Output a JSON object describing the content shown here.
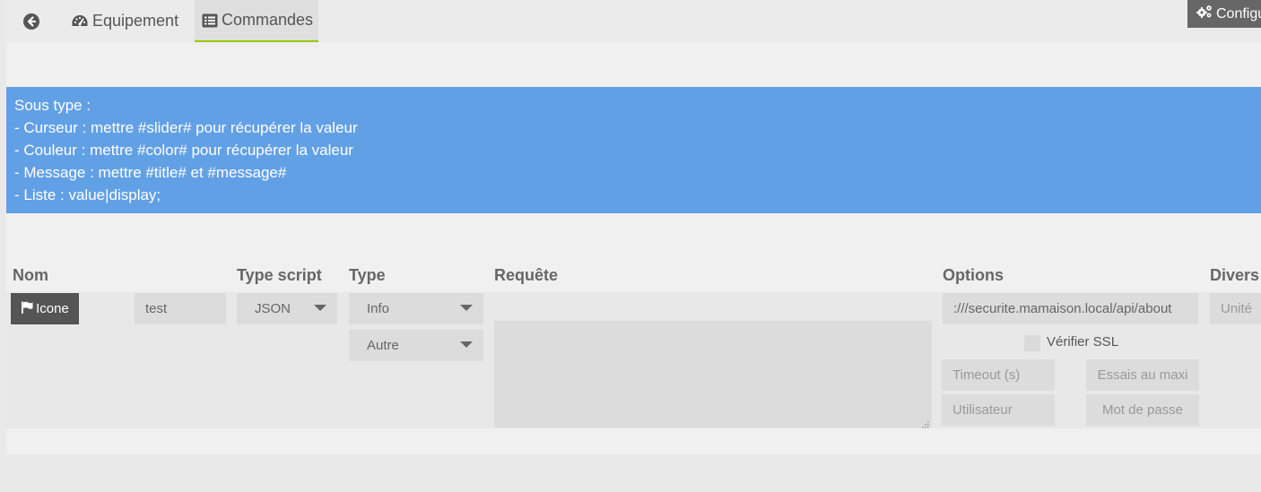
{
  "tabs": {
    "back_icon": "arrow-circle-left-icon",
    "equipement": {
      "label": "Equipement",
      "icon": "tachometer-icon"
    },
    "commandes": {
      "label": "Commandes",
      "icon": "list-alt-icon"
    }
  },
  "config_button": {
    "label": "Configu",
    "icon": "cogs-icon"
  },
  "alert": {
    "lines": [
      "Sous type :",
      "- Curseur : mettre #slider# pour récupérer la valeur",
      "- Couleur : mettre #color# pour récupérer la valeur",
      "- Message : mettre #title# et #message#",
      "- Liste : value|display;"
    ]
  },
  "table": {
    "headers": {
      "nom": "Nom",
      "type_script": "Type script",
      "type": "Type",
      "requete": "Requête",
      "options": "Options",
      "divers": "Divers"
    },
    "row": {
      "icone_button": {
        "label": "Icone",
        "icon": "flag-icon"
      },
      "name_value": "test",
      "type_script_value": "JSON",
      "type_value": "Info",
      "subtype_value": "Autre",
      "requete_value": "",
      "url_value": ":///securite.mamaison.local/api/about",
      "verify_ssl_label": "Vérifier SSL",
      "verify_ssl_checked": false,
      "timeout_placeholder": "Timeout (s)",
      "essais_placeholder": "Essais au maxi",
      "user_placeholder": "Utilisateur",
      "password_placeholder": "Mot de passe",
      "unite_placeholder": "Unité"
    }
  },
  "colors": {
    "alert_bg": "#62a0e6",
    "tab_active_border": "#94ca02",
    "button_dark": "#555555"
  }
}
